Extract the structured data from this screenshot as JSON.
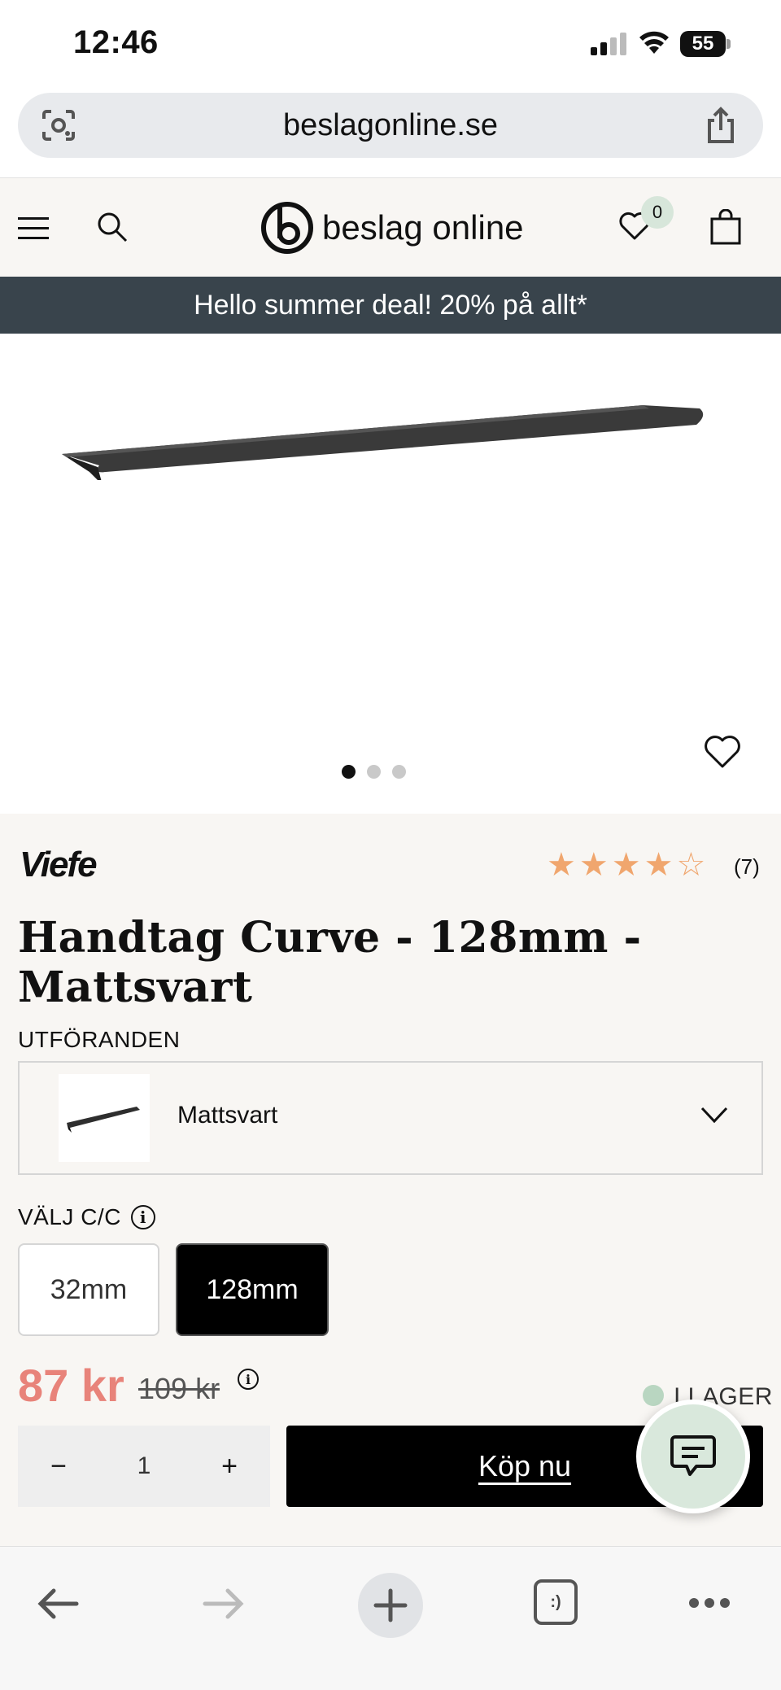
{
  "status_bar": {
    "time": "12:46",
    "battery": "55"
  },
  "browser": {
    "url": "beslagonline.se"
  },
  "header": {
    "logo_text": "beslag online",
    "wishlist_count": "0"
  },
  "promo": {
    "text": "Hello summer deal! 20% på allt*"
  },
  "gallery": {
    "slide_count": 3,
    "active_slide": 1
  },
  "product": {
    "brand": "Viefe",
    "rating_stars": 4,
    "review_count": "(7)",
    "title": "Handtag Curve - 128mm - Mattsvart",
    "variant_label": "UTFÖRANDEN",
    "variant_value": "Mattsvart",
    "cc_label": "VÄLJ C/C",
    "cc_options": [
      "32mm",
      "128mm"
    ],
    "cc_selected": "128mm",
    "price": "87 kr",
    "old_price": "109 kr",
    "stock": "I LAGER",
    "quantity": "1",
    "buy_label": "Köp nu"
  },
  "colors": {
    "promo_bg": "#39444c",
    "price": "#e8837a",
    "stars": "#f0a66e",
    "stock_dot": "#b9d6c1",
    "chat_bg": "#d9e8dc"
  }
}
